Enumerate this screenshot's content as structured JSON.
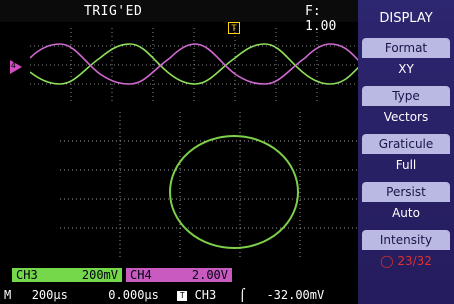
{
  "header": {
    "trigger_status": "TRIG'ED",
    "frequency": "F: 1.00"
  },
  "markers": {
    "trigger": "T",
    "channel": "4"
  },
  "menu": {
    "title": "DISPLAY",
    "items": [
      {
        "label": "Format",
        "value": "XY"
      },
      {
        "label": "Type",
        "value": "Vectors"
      },
      {
        "label": "Graticule",
        "value": "Full"
      },
      {
        "label": "Persist",
        "value": "Auto"
      },
      {
        "label": "Intensity",
        "value": "◯ 23/32"
      }
    ]
  },
  "channels": {
    "ch3": {
      "name": "CH3",
      "scale": "200mV",
      "color": "#75d84a"
    },
    "ch4": {
      "name": "CH4",
      "scale": "2.00V",
      "color": "#c85ac0"
    }
  },
  "timebase": {
    "mode": "M",
    "scale": "200µs",
    "position": "0.000µs",
    "trigger_icon": "T",
    "trigger_source": "CH3",
    "slope": "⌠",
    "level": "-32.00mV"
  }
}
